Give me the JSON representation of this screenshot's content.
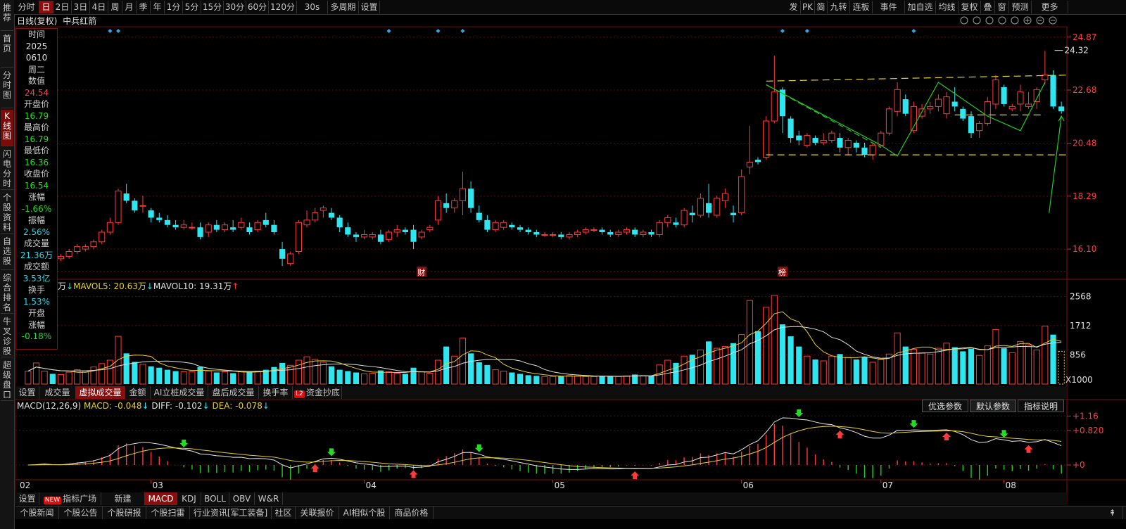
{
  "left_tabs": [
    "推荐",
    "首页",
    "分时图",
    "K线图",
    "闪电分时",
    "个股资料",
    "自选股",
    "综合排名",
    "牛叉诊股",
    "超级盘口"
  ],
  "toolbar": {
    "left": [
      "分时",
      "日",
      "2日",
      "3日",
      "4日",
      "周",
      "月",
      "季",
      "年",
      "1分",
      "5分",
      "15分",
      "30分",
      "60分",
      "120分",
      "30s",
      "多周期",
      "设置"
    ],
    "selected": "日",
    "right": [
      "发",
      "PK",
      "简",
      "九转",
      "连板",
      "事件",
      "加自选",
      "均线",
      "复权",
      "叠",
      "窗",
      "预测",
      "更多"
    ]
  },
  "chart_header": {
    "period": "日线(复权)",
    "name": "中兵红箭"
  },
  "info_panel": [
    {
      "label": "时间",
      "value": "2025",
      "value2": "0610",
      "value3": "周二",
      "color": "white"
    },
    {
      "label": "数值",
      "value": "24.54",
      "color": "red"
    },
    {
      "label": "开盘价",
      "value": "16.79",
      "color": "green"
    },
    {
      "label": "最高价",
      "value": "16.79",
      "color": "green"
    },
    {
      "label": "最低价",
      "value": "16.36",
      "color": "green"
    },
    {
      "label": "收盘价",
      "value": "16.54",
      "color": "green"
    },
    {
      "label": "涨幅",
      "value": "-1.66%",
      "color": "green"
    },
    {
      "label": "振幅",
      "value": "2.56%",
      "color": "cyan"
    },
    {
      "label": "成交量",
      "value": "21.36万",
      "color": "cyan"
    },
    {
      "label": "成交额",
      "value": "3.53亿",
      "color": "cyan"
    },
    {
      "label": "换手",
      "value": "1.53%",
      "color": "cyan"
    },
    {
      "label": "开盘涨幅",
      "value": "-0.18%",
      "color": "green"
    }
  ],
  "price_axis": [
    "24.87",
    "22.68",
    "20.48",
    "18.29",
    "16.10"
  ],
  "price_high_label": "24.32",
  "event_markers": [
    "财",
    "榜"
  ],
  "vol_header": {
    "prefix": "万",
    "ma5": "MAVOL5: 20.63万",
    "ma10": "MAVOL10: 19.31万"
  },
  "vol_axis": [
    "2568",
    "1712",
    "856",
    "X1000"
  ],
  "vol_tabs": [
    "设置",
    "成交量",
    "虚拟成交量",
    "金额",
    "AI立桩成交量",
    "盘后成交量",
    "换手率",
    "资金抄底"
  ],
  "vol_tab_selected": "虚拟成交量",
  "macd_header": {
    "name": "MACD(12,26,9)",
    "macd": "MACD: -0.048",
    "diff": "DIFF: -0.102",
    "dea": "DEA: -0.078"
  },
  "macd_buttons": [
    "优选参数",
    "默认参数",
    "指标说明"
  ],
  "macd_axis": [
    "+1.16",
    "+0.820",
    "+0"
  ],
  "months": [
    "02",
    "03",
    "04",
    "05",
    "06",
    "07",
    "08"
  ],
  "indicator_tabs": [
    "设置",
    "指标广场",
    "新建",
    "MACD",
    "KDJ",
    "BOLL",
    "OBV",
    "W&R"
  ],
  "indicator_new_badge": "NEW",
  "indicator_selected": "MACD",
  "bottom_tabs": [
    "个股新闻",
    "个股公告",
    "个股研报",
    "个股扫雷",
    "行业资讯[军工装备]",
    "社区",
    "关联报价",
    "AI相似个股",
    "商品价格"
  ],
  "colors": {
    "up": "#ff3a3a",
    "down": "#2ee6f0",
    "ma5": "#e6d22a",
    "ma10": "#e0e0e0",
    "axis": "#7a1010"
  },
  "chart_data": {
    "type": "candlestick",
    "title": "中兵红箭",
    "price_range": [
      15.2,
      25.3
    ],
    "candles": [
      [
        15.6,
        15.9,
        15.5,
        15.8
      ],
      [
        15.8,
        16.0,
        15.7,
        15.9
      ],
      [
        15.9,
        16.1,
        15.8,
        16.0
      ],
      [
        16.0,
        16.2,
        15.6,
        15.7
      ],
      [
        15.7,
        15.9,
        15.6,
        15.8
      ],
      [
        15.8,
        16.1,
        15.7,
        16.0
      ],
      [
        16.0,
        16.3,
        15.9,
        16.2
      ],
      [
        16.1,
        16.3,
        16.0,
        16.2
      ],
      [
        16.2,
        16.5,
        16.1,
        16.4
      ],
      [
        16.4,
        16.9,
        16.3,
        16.8
      ],
      [
        16.8,
        17.4,
        16.7,
        17.2
      ],
      [
        17.2,
        18.6,
        17.1,
        18.5
      ],
      [
        18.4,
        18.8,
        18.0,
        18.1
      ],
      [
        18.1,
        18.2,
        17.6,
        17.7
      ],
      [
        17.9,
        18.3,
        17.6,
        17.9
      ],
      [
        17.7,
        17.8,
        17.2,
        17.4
      ],
      [
        17.4,
        17.6,
        17.2,
        17.3
      ],
      [
        17.3,
        17.5,
        17.0,
        17.1
      ],
      [
        17.1,
        17.3,
        16.9,
        17.0
      ],
      [
        17.0,
        17.3,
        16.9,
        17.1
      ],
      [
        17.0,
        17.2,
        16.9,
        17.0
      ],
      [
        17.0,
        17.2,
        16.5,
        16.6
      ],
      [
        16.8,
        17.2,
        16.6,
        17.1
      ],
      [
        17.1,
        17.3,
        16.8,
        16.9
      ],
      [
        16.9,
        17.2,
        16.8,
        17.1
      ],
      [
        17.0,
        17.3,
        16.8,
        16.9
      ],
      [
        17.0,
        17.4,
        16.9,
        17.2
      ],
      [
        17.0,
        17.2,
        16.7,
        16.8
      ],
      [
        16.9,
        17.3,
        16.8,
        17.2
      ],
      [
        17.3,
        17.6,
        17.0,
        17.1
      ],
      [
        17.1,
        17.3,
        16.7,
        16.8
      ],
      [
        16.1,
        16.4,
        15.4,
        15.7
      ],
      [
        15.5,
        16.0,
        15.4,
        15.9
      ],
      [
        16.0,
        17.3,
        15.9,
        17.2
      ],
      [
        17.1,
        17.7,
        17.0,
        17.3
      ],
      [
        17.3,
        17.8,
        17.2,
        17.6
      ],
      [
        17.7,
        17.9,
        17.4,
        17.8
      ],
      [
        17.6,
        17.8,
        17.3,
        17.4
      ],
      [
        17.4,
        17.5,
        16.8,
        17.0
      ],
      [
        17.0,
        17.2,
        16.6,
        16.7
      ],
      [
        16.7,
        16.8,
        16.4,
        16.6
      ],
      [
        16.6,
        16.9,
        16.5,
        16.7
      ],
      [
        16.6,
        16.8,
        16.5,
        16.7
      ],
      [
        16.7,
        16.9,
        16.3,
        16.4
      ],
      [
        16.5,
        16.9,
        16.4,
        16.8
      ],
      [
        16.8,
        17.1,
        16.6,
        16.9
      ],
      [
        16.9,
        17.0,
        16.7,
        16.8
      ],
      [
        16.9,
        17.1,
        16.1,
        16.4
      ],
      [
        16.6,
        16.9,
        16.5,
        16.8
      ],
      [
        16.9,
        17.1,
        16.8,
        17.0
      ],
      [
        17.3,
        18.3,
        17.1,
        18.1
      ],
      [
        18.0,
        18.4,
        17.6,
        17.8
      ],
      [
        17.8,
        18.2,
        17.6,
        18.1
      ],
      [
        18.1,
        19.3,
        17.5,
        18.6
      ],
      [
        18.6,
        18.9,
        17.6,
        17.8
      ],
      [
        17.6,
        17.9,
        17.2,
        17.3
      ],
      [
        17.3,
        17.5,
        16.8,
        16.9
      ],
      [
        16.9,
        17.3,
        16.8,
        17.2
      ],
      [
        17.0,
        17.3,
        16.9,
        17.2
      ],
      [
        17.1,
        17.2,
        16.9,
        17.0
      ],
      [
        17.0,
        17.1,
        16.8,
        16.9
      ],
      [
        16.9,
        17.0,
        16.7,
        16.8
      ],
      [
        16.8,
        16.9,
        16.6,
        16.7
      ],
      [
        16.7,
        16.8,
        16.6,
        16.7
      ],
      [
        16.7,
        16.8,
        16.6,
        16.7
      ],
      [
        16.7,
        16.8,
        16.5,
        16.6
      ],
      [
        16.6,
        16.8,
        16.5,
        16.7
      ],
      [
        16.7,
        16.9,
        16.6,
        16.8
      ],
      [
        16.8,
        17.0,
        16.7,
        16.9
      ],
      [
        16.9,
        17.0,
        16.8,
        16.9
      ],
      [
        16.9,
        17.0,
        16.7,
        16.8
      ],
      [
        16.8,
        16.9,
        16.6,
        16.7
      ],
      [
        16.7,
        16.9,
        16.6,
        16.8
      ],
      [
        16.8,
        17.0,
        16.7,
        16.9
      ],
      [
        16.9,
        17.0,
        16.6,
        16.7
      ],
      [
        16.7,
        16.9,
        16.6,
        16.8
      ],
      [
        16.8,
        16.9,
        16.6,
        16.7
      ],
      [
        16.7,
        17.3,
        16.6,
        17.2
      ],
      [
        17.2,
        17.5,
        17.0,
        17.4
      ],
      [
        17.2,
        17.4,
        17.0,
        17.1
      ],
      [
        17.1,
        17.8,
        17.0,
        17.7
      ],
      [
        17.6,
        17.9,
        17.2,
        17.5
      ],
      [
        17.5,
        18.4,
        17.4,
        18.2
      ],
      [
        18.0,
        18.8,
        17.4,
        17.6
      ],
      [
        17.5,
        18.3,
        17.4,
        18.2
      ],
      [
        18.1,
        18.6,
        17.8,
        18.4
      ],
      [
        17.6,
        17.9,
        17.2,
        17.5
      ],
      [
        17.6,
        19.4,
        17.5,
        19.1
      ],
      [
        19.5,
        21.2,
        19.2,
        19.7
      ],
      [
        19.8,
        19.9,
        19.6,
        19.7
      ],
      [
        19.9,
        21.6,
        19.8,
        21.4
      ],
      [
        21.4,
        24.1,
        21.3,
        22.6
      ],
      [
        22.7,
        22.8,
        20.9,
        21.6
      ],
      [
        21.5,
        21.6,
        20.5,
        20.7
      ],
      [
        20.8,
        21.0,
        20.4,
        20.6
      ],
      [
        20.4,
        20.9,
        20.3,
        20.8
      ],
      [
        20.7,
        20.8,
        20.4,
        20.5
      ],
      [
        20.5,
        20.9,
        20.4,
        20.6
      ],
      [
        20.6,
        21.0,
        20.5,
        20.9
      ],
      [
        20.7,
        20.9,
        20.1,
        20.3
      ],
      [
        20.3,
        20.7,
        20.0,
        20.6
      ],
      [
        20.5,
        20.6,
        20.1,
        20.3
      ],
      [
        20.3,
        20.5,
        19.9,
        20.0
      ],
      [
        20.0,
        20.5,
        19.8,
        20.4
      ],
      [
        20.4,
        21.0,
        20.3,
        20.9
      ],
      [
        20.9,
        22.0,
        20.8,
        21.9
      ],
      [
        21.8,
        23.0,
        21.6,
        22.7
      ],
      [
        22.3,
        22.5,
        21.6,
        21.7
      ],
      [
        21.0,
        22.2,
        20.9,
        22.0
      ],
      [
        21.6,
        22.1,
        21.5,
        21.9
      ],
      [
        21.9,
        22.2,
        21.7,
        22.0
      ],
      [
        22.0,
        22.5,
        21.8,
        22.3
      ],
      [
        21.7,
        22.6,
        21.5,
        22.4
      ],
      [
        22.2,
        22.8,
        21.8,
        22.0
      ],
      [
        21.9,
        22.0,
        21.4,
        21.5
      ],
      [
        21.6,
        21.8,
        20.7,
        20.9
      ],
      [
        21.0,
        21.4,
        20.7,
        21.3
      ],
      [
        21.3,
        22.4,
        21.2,
        22.2
      ],
      [
        22.1,
        23.3,
        21.9,
        23.1
      ],
      [
        22.8,
        22.9,
        22.0,
        22.1
      ],
      [
        21.9,
        22.1,
        21.8,
        22.0
      ],
      [
        22.1,
        22.9,
        21.8,
        22.6
      ],
      [
        22.0,
        22.6,
        21.9,
        22.1
      ],
      [
        22.2,
        22.8,
        21.9,
        22.7
      ],
      [
        23.1,
        24.3,
        22.9,
        23.3
      ],
      [
        23.3,
        23.5,
        21.9,
        22.0
      ],
      [
        22.0,
        22.2,
        21.7,
        21.8
      ]
    ],
    "volume_k": [
      380,
      620,
      380,
      300,
      280,
      350,
      420,
      380,
      500,
      600,
      700,
      1400,
      900,
      650,
      580,
      520,
      480,
      420,
      380,
      360,
      360,
      500,
      380,
      340,
      360,
      320,
      380,
      340,
      380,
      420,
      500,
      620,
      550,
      700,
      800,
      720,
      640,
      520,
      420,
      380,
      340,
      300,
      320,
      400,
      360,
      320,
      300,
      480,
      360,
      320,
      700,
      1100,
      820,
      1350,
      900,
      640,
      560,
      420,
      380,
      340,
      300,
      260,
      240,
      220,
      220,
      230,
      250,
      240,
      220,
      220,
      240,
      230,
      220,
      240,
      280,
      250,
      240,
      560,
      700,
      620,
      820,
      860,
      1000,
      1250,
      1050,
      1100,
      1200,
      1450,
      2450,
      1550,
      2250,
      2600,
      1750,
      1400,
      1100,
      820,
      720,
      680,
      820,
      880,
      780,
      720,
      800,
      640,
      720,
      880,
      1500,
      1100,
      1020,
      920,
      880,
      1050,
      1200,
      1080,
      960,
      1040,
      840,
      1120,
      1600,
      1050,
      920,
      1250,
      1150,
      1000,
      1700,
      1450,
      960
    ],
    "volume_axis_range": [
      0,
      2700
    ],
    "macd_range": [
      -0.25,
      1.25
    ]
  }
}
